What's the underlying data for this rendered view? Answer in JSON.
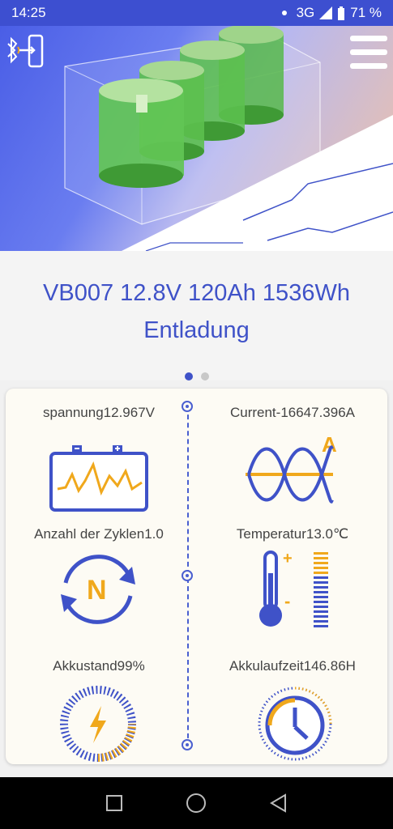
{
  "status": {
    "time": "14:25",
    "network": "3G",
    "battery": "71 %"
  },
  "header": {
    "bt_icon": "bluetooth-exit-icon",
    "menu_icon": "hamburger-menu-icon"
  },
  "title": {
    "line1": "VB007 12.8V 120Ah 1536Wh",
    "line2": "Entladung"
  },
  "metrics": {
    "voltage": {
      "label": "spannung12.967V",
      "icon": "battery-wave-icon"
    },
    "current": {
      "label": "Current-16647.396A",
      "icon": "sine-wave-icon"
    },
    "cycles": {
      "label": "Anzahl der Zyklen1.0",
      "icon": "cycle-n-icon"
    },
    "temperature": {
      "label": "Temperatur13.0℃",
      "icon": "thermometer-icon"
    },
    "state": {
      "label": "Akkustand99%",
      "icon": "charge-gauge-icon"
    },
    "runtime": {
      "label": "Akkulaufzeit146.86H",
      "icon": "clock-icon"
    }
  },
  "colors": {
    "primary": "#3f52c8",
    "accent": "#f0a81c",
    "statusbar": "#3d4fd0"
  },
  "nav": {
    "recent": "square-icon",
    "home": "circle-icon",
    "back": "triangle-icon"
  }
}
